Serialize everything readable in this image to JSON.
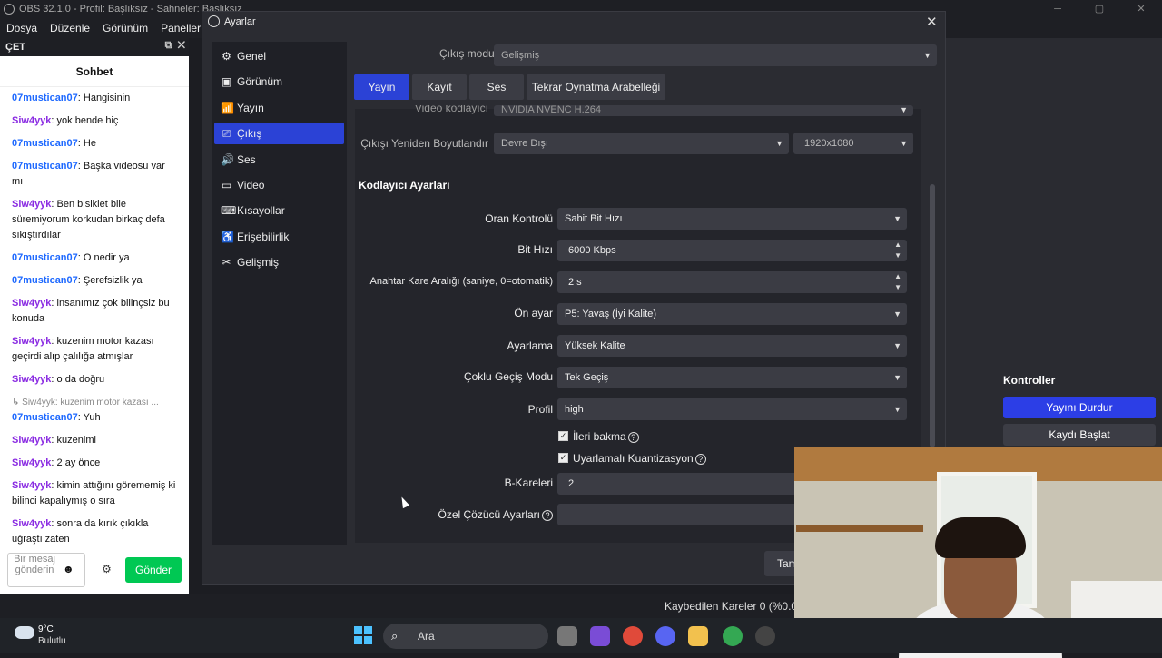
{
  "obs": {
    "title": "OBS 32.1.0 - Profil: Başlıksız - Sahneler: Başlıksız",
    "menu": [
      "Dosya",
      "Düzenle",
      "Görünüm",
      "Paneller"
    ],
    "chat_dock_label": "ÇET",
    "status_dropped": "Kaybedilen Kareler 0 (%0.0)"
  },
  "chat": {
    "title": "Sohbet",
    "messages": [
      {
        "user": "07mustican07",
        "text": ": Hangisinin",
        "color": "u1"
      },
      {
        "user": "Siw4yyk",
        "text": ": yok bende hiç",
        "color": "u2"
      },
      {
        "user": "07mustican07",
        "text": ": He",
        "color": "u1"
      },
      {
        "user": "07mustican07",
        "text": ": Başka videosu var mı",
        "color": "u1"
      },
      {
        "user": "Siw4yyk",
        "text": ": Ben bisiklet bile süremiyorum korkudan birkaç defa sıkıştırdılar",
        "color": "u2"
      },
      {
        "user": "07mustican07",
        "text": ": O nedir ya",
        "color": "u1"
      },
      {
        "user": "07mustican07",
        "text": ": Şerefsizlik ya",
        "color": "u1"
      },
      {
        "user": "Siw4yyk",
        "text": ": insanımız çok bilinçsiz bu konuda",
        "color": "u2"
      },
      {
        "user": "Siw4yyk",
        "text": ": kuzenim motor kazası geçirdi alıp çalılığa atmışlar",
        "color": "u2"
      },
      {
        "user": "Siw4yyk",
        "text": ": o da doğru",
        "color": "u2"
      }
    ],
    "reply_hint": "↳ Siw4yyk: kuzenim motor kazası ...",
    "messages2": [
      {
        "user": "07mustican07",
        "text": ": Yuh",
        "color": "u1"
      },
      {
        "user": "Siw4yyk",
        "text": ": kuzenimi",
        "color": "u2"
      },
      {
        "user": "Siw4yyk",
        "text": ": 2 ay önce",
        "color": "u2"
      },
      {
        "user": "Siw4yyk",
        "text": ": kimin attığını görememiş ki bilinci kapalıymış o sıra",
        "color": "u2"
      },
      {
        "user": "Siw4yyk",
        "text": ": sonra da kırık çıkıkla uğraştı zaten",
        "color": "u2"
      }
    ],
    "input_placeholder": "Bir mesaj gönderin",
    "send_label": "Gönder"
  },
  "controls": {
    "title": "Kontroller",
    "stop_stream": "Yayını Durdur",
    "start_record": "Kaydı Başlat"
  },
  "dialog": {
    "title": "Ayarlar",
    "close": "✕",
    "nav": [
      {
        "label": "Genel",
        "icon": "gear-icon",
        "glyph": "⚙"
      },
      {
        "label": "Görünüm",
        "icon": "appearance-icon",
        "glyph": "▣"
      },
      {
        "label": "Yayın",
        "icon": "antenna-icon",
        "glyph": "📶"
      },
      {
        "label": "Çıkış",
        "icon": "output-icon",
        "glyph": "⎚"
      },
      {
        "label": "Ses",
        "icon": "speaker-icon",
        "glyph": "🔊"
      },
      {
        "label": "Video",
        "icon": "monitor-icon",
        "glyph": "▭"
      },
      {
        "label": "Kısayollar",
        "icon": "keyboard-icon",
        "glyph": "⌨"
      },
      {
        "label": "Erişebilirlik",
        "icon": "accessibility-icon",
        "glyph": "♿"
      },
      {
        "label": "Gelişmiş",
        "icon": "tools-icon",
        "glyph": "✂"
      }
    ],
    "output_mode_label": "Çıkış modu",
    "output_mode_value": "Gelişmiş",
    "tabs": [
      "Yayın",
      "Kayıt",
      "Ses",
      "Tekrar Oynatma Arabelleği"
    ],
    "encoder_label": "Video kodlayıcı",
    "encoder_value": "NVIDIA NVENC H.264",
    "rescale_label": "Çıkışı Yeniden Boyutlandır",
    "rescale_value": "Devre Dışı",
    "rescale_res": "1920x1080",
    "section_title": "Kodlayıcı Ayarları",
    "rate_control_label": "Oran Kontrolü",
    "rate_control_value": "Sabit Bit Hızı",
    "bitrate_label": "Bit Hızı",
    "bitrate_value": "6000 Kbps",
    "keyframe_label": "Anahtar Kare Aralığı (saniye, 0=otomatik)",
    "keyframe_value": "2 s",
    "preset_label": "Ön ayar",
    "preset_value": "P5: Yavaş (İyi Kalite)",
    "tuning_label": "Ayarlama",
    "tuning_value": "Yüksek Kalite",
    "multipass_label": "Çoklu Geçiş Modu",
    "multipass_value": "Tek Geçiş",
    "profile_label": "Profil",
    "profile_value": "high",
    "lookahead_label": "İleri bakma",
    "aq_label": "Uyarlamalı Kuantizasyon",
    "bframes_label": "B-Kareleri",
    "bframes_value": "2",
    "custom_label": "Özel Çözücü Ayarları",
    "apply_label": "Tamam"
  },
  "taskbar": {
    "temp": "9°C",
    "weather": "Bulutlu",
    "search": "Ara"
  }
}
